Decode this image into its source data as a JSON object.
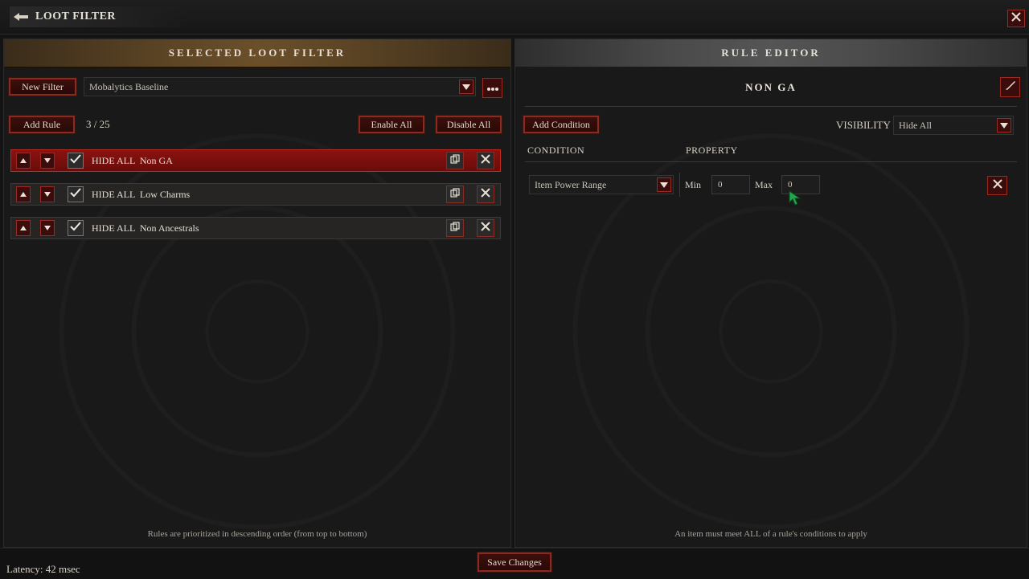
{
  "window": {
    "title": "LOOT FILTER"
  },
  "left_panel": {
    "header": "SELECTED LOOT FILTER",
    "new_filter_label": "New Filter",
    "filter_select_value": "Mobalytics Baseline",
    "add_rule_label": "Add Rule",
    "rule_count": "3 / 25",
    "enable_all_label": "Enable All",
    "disable_all_label": "Disable All",
    "rules": [
      {
        "visibility": "HIDE ALL",
        "name": "Non GA",
        "checked": true,
        "selected": true
      },
      {
        "visibility": "HIDE ALL",
        "name": "Low Charms",
        "checked": true,
        "selected": false
      },
      {
        "visibility": "HIDE ALL",
        "name": "Non Ancestrals",
        "checked": true,
        "selected": false
      }
    ],
    "footnote": "Rules are prioritized in descending order (from top to bottom)"
  },
  "right_panel": {
    "header": "RULE EDITOR",
    "rule_name": "NON GA",
    "add_condition_label": "Add Condition",
    "visibility_label": "VISIBILITY",
    "visibility_value": "Hide All",
    "condition_header": "CONDITION",
    "property_header": "PROPERTY",
    "condition_row": {
      "type": "Item Power Range",
      "min_label": "Min",
      "min_value": "0",
      "max_label": "Max",
      "max_value": "0"
    },
    "footnote": "An item must meet ALL of a rule's conditions to apply"
  },
  "footer": {
    "save_label": "Save Changes",
    "latency": "Latency: 42 msec"
  },
  "colors": {
    "accent_red": "#8c2a20",
    "selected_row": "#8a1210",
    "cursor_green": "#1fa84a"
  }
}
